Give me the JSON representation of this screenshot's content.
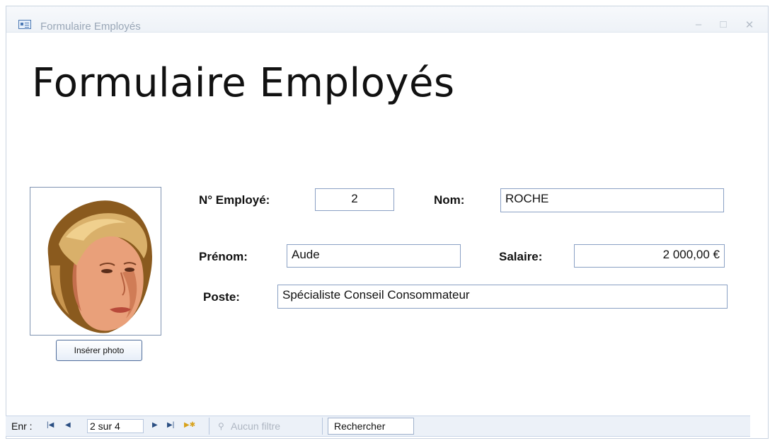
{
  "window": {
    "title": "Formulaire Employés",
    "icons": {
      "app": "form-icon",
      "minimize": "minimize-icon",
      "maximize": "maximize-icon",
      "close": "close-icon"
    }
  },
  "form": {
    "heading": "Formulaire Employés",
    "photo_button": "Insérer photo",
    "fields": {
      "employee_no": {
        "label": "N° Employé:",
        "value": "2"
      },
      "nom": {
        "label": "Nom:",
        "value": "ROCHE"
      },
      "prenom": {
        "label": "Prénom:",
        "value": "Aude"
      },
      "salaire": {
        "label": "Salaire:",
        "value": "2 000,00 €"
      },
      "poste": {
        "label": "Poste:",
        "value": "Spécialiste Conseil Consommateur"
      }
    }
  },
  "navigation": {
    "record_label": "Enr :",
    "record_position": "2 sur 4",
    "filter_label": "Aucun filtre",
    "search_label": "Rechercher",
    "icons": {
      "first": "first-record-icon",
      "prev": "previous-record-icon",
      "next": "next-record-icon",
      "last": "last-record-icon",
      "new": "new-record-icon",
      "filter": "filter-icon"
    }
  }
}
